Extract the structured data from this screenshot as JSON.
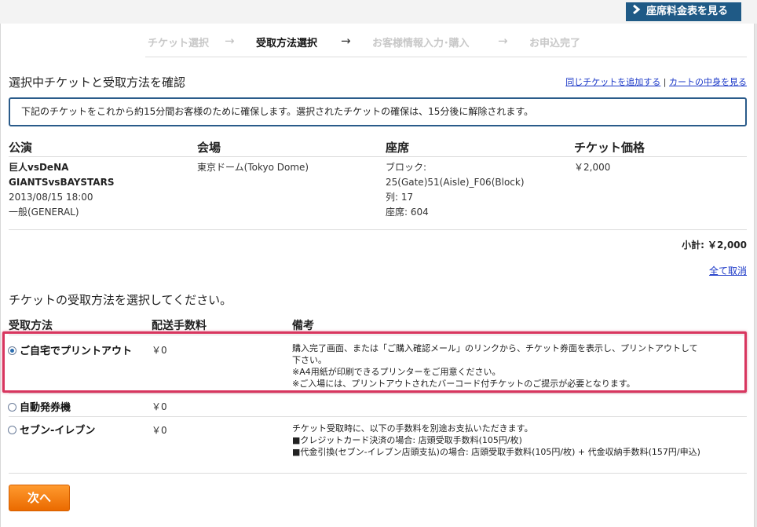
{
  "header": {
    "rate_button_label": "座席料金表を見る"
  },
  "steps": [
    {
      "label": "チケット選択",
      "state": "inactive"
    },
    {
      "label": "受取方法選択",
      "state": "active"
    },
    {
      "label": "お客様情報入力･購入",
      "state": "inactive"
    },
    {
      "label": "お申込完了",
      "state": "inactive"
    }
  ],
  "step_arrow": "→",
  "confirm": {
    "title": "選択中チケットと受取方法を確認",
    "link_add_same": "同じチケットを追加する",
    "separator": "|",
    "link_view_cart": "カートの中身を見る",
    "notice": "下記のチケットをこれから約15分間お客様のために確保します。選択されたチケットの確保は、15分後に解除されます。"
  },
  "ticket_table": {
    "headers": [
      "公演",
      "会場",
      "座席",
      "チケット価格"
    ],
    "event_line1": "巨人vsDeNA",
    "event_line2": "GIANTSvsBAYSTARS",
    "event_date": "2013/08/15 18:00",
    "event_type": "一般(GENERAL)",
    "venue": "東京ドーム(Tokyo Dome)",
    "seat_block_label": "ブロック:",
    "seat_block_value": "25(Gate)51(Aisle)_F06(Block)",
    "seat_row": "列: 17",
    "seat_number": "座席: 604",
    "price": "￥2,000",
    "subtotal": "小計: ￥2,000",
    "cancel_all": "全て取消"
  },
  "delivery": {
    "prompt": "チケットの受取方法を選択してください。",
    "headers": [
      "受取方法",
      "配送手数料",
      "備考"
    ],
    "methods": [
      {
        "label": "ご自宅でプリントアウト",
        "fee": "￥0",
        "selected": true,
        "notes": [
          "購入完了画面、または「ご購入確認メール」のリンクから、チケット券面を表示し、プリントアウトして下さい。",
          "※A4用紙が印刷できるプリンターをご用意ください。",
          "※ご入場には、プリントアウトされたバーコード付チケットのご提示が必要となります。"
        ]
      },
      {
        "label": "自動発券機",
        "fee": "￥0",
        "selected": false,
        "notes": []
      },
      {
        "label": "セブン-イレブン",
        "fee": "￥0",
        "selected": false,
        "notes": [
          "チケット受取時に、以下の手数料を別途お支払いただきます。",
          "■クレジットカード決済の場合: 店頭受取手数料(105円/枚)",
          "■代金引換(セブン-イレブン店頭支払)の場合: 店頭受取手数料(105円/枚) + 代金収納手数料(157円/申込)"
        ]
      }
    ]
  },
  "actions": {
    "next_label": "次へ"
  },
  "colors": {
    "accent_blue": "#1f5a86",
    "link": "#1a37c7",
    "highlight": "#d8365f",
    "next_button": "#f07d10"
  }
}
